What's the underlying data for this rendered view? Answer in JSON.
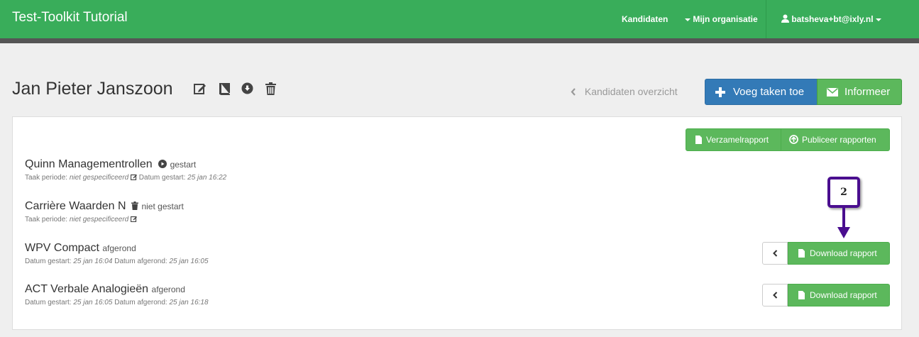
{
  "navbar": {
    "brand": "Test-Toolkit Tutorial",
    "links": [
      "Kandidaten",
      "Mijn organisatie"
    ],
    "user": "batsheva+bt@ixly.nl"
  },
  "header": {
    "title": "Jan Pieter Janszoon",
    "back_label": "Kandidaten overzicht",
    "add_tasks_label": "Voeg taken toe",
    "inform_label": "Informeer"
  },
  "panel": {
    "summary_report_label": "Verzamelrapport",
    "publish_reports_label": "Publiceer rapporten",
    "tasks": [
      {
        "name": "Quinn Managementrollen",
        "status": "gestart",
        "meta": [
          {
            "label": "Taak periode:",
            "value": "niet gespecificeerd"
          },
          {
            "label": "Datum gestart:",
            "value": "25 jan 16:22"
          }
        ]
      },
      {
        "name": "Carrière Waarden N",
        "status": "niet gestart",
        "meta": [
          {
            "label": "Taak periode:",
            "value": "niet gespecificeerd"
          }
        ]
      },
      {
        "name": "WPV Compact",
        "status": "afgerond",
        "meta": [
          {
            "label": "Datum gestart:",
            "value": "25 jan 16:04"
          },
          {
            "label": "Datum afgerond:",
            "value": "25 jan 16:05"
          }
        ],
        "download_label": "Download rapport"
      },
      {
        "name": "ACT Verbale Analogieën",
        "status": "afgerond",
        "meta": [
          {
            "label": "Datum gestart:",
            "value": "25 jan 16:05"
          },
          {
            "label": "Datum afgerond:",
            "value": "25 jan 16:18"
          }
        ],
        "download_label": "Download rapport"
      }
    ]
  },
  "annotation": {
    "step": "2",
    "color": "#4a0e8f"
  },
  "colors": {
    "navbar": "#39ad5a",
    "primary": "#337ab7",
    "success": "#5cb85c"
  }
}
